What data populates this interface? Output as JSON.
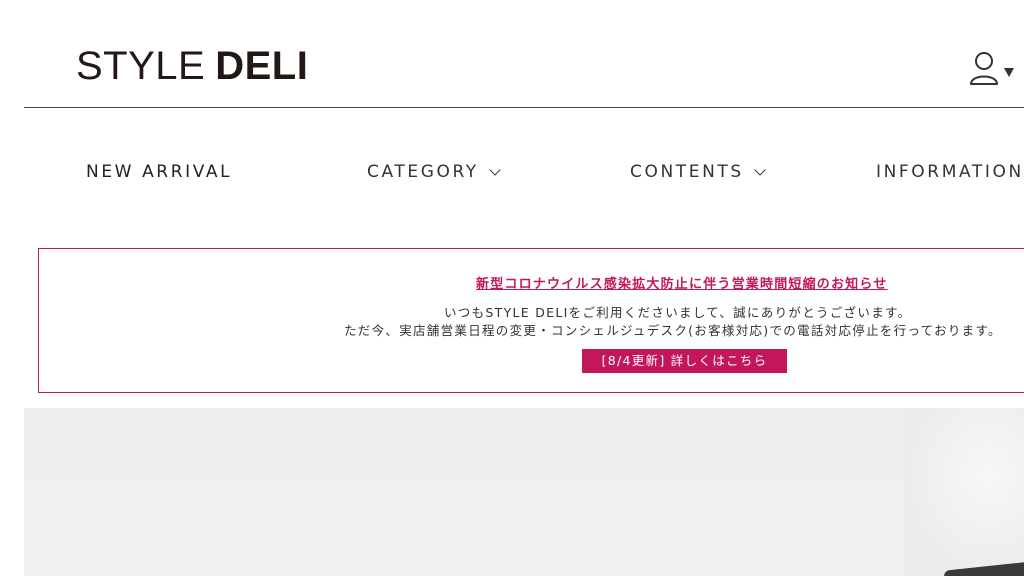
{
  "header": {
    "logo_light": "STYLE",
    "logo_bold": "DELI",
    "account_icon": "user-account-icon",
    "account_caret_icon": "caret-down-icon"
  },
  "nav": {
    "items": [
      {
        "label": "NEW ARRIVAL",
        "has_dropdown": false
      },
      {
        "label": "CATEGORY",
        "has_dropdown": true
      },
      {
        "label": "CONTENTS",
        "has_dropdown": true
      },
      {
        "label": "INFORMATION",
        "has_dropdown": false
      }
    ]
  },
  "notice": {
    "title": "新型コロナウイルス感染拡大防止に伴う営業時間短縮のお知らせ",
    "line1": "いつもSTYLE DELIをご利用くださいまして、誠にありがとうございます。",
    "line2": "ただ今、実店舗営業日程の変更・コンシェルジュデスク(お客様対応)での電話対応停止を行っております。",
    "button_label": "[8/4更新] 詳しくはこちら"
  },
  "colors": {
    "accent": "#c2185b",
    "text": "#222222",
    "hero_bg": "#eeeeee"
  }
}
